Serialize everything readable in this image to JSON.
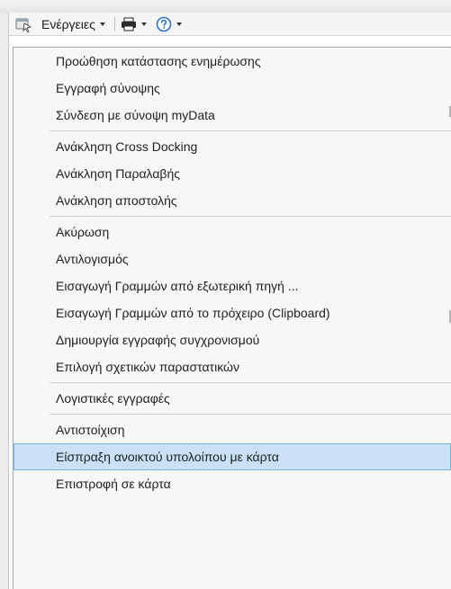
{
  "toolbar": {
    "actions_label": "Ενέργειες",
    "icons": [
      "actions-app-icon",
      "printer-icon",
      "help-icon"
    ]
  },
  "menu": {
    "groups": [
      {
        "items": [
          {
            "label": "Προώθηση κατάστασης ενημέρωσης"
          },
          {
            "label": "Εγγραφή σύνοψης"
          },
          {
            "label": "Σύνδεση με σύνοψη myData"
          }
        ]
      },
      {
        "items": [
          {
            "label": "Ανάκληση Cross Docking"
          },
          {
            "label": "Ανάκληση Παραλαβής"
          },
          {
            "label": "Ανάκληση αποστολής"
          }
        ]
      },
      {
        "items": [
          {
            "label": "Ακύρωση"
          },
          {
            "label": "Αντιλογισμός"
          },
          {
            "label": "Εισαγωγή Γραμμών από εξωτερική πηγή ..."
          },
          {
            "label": "Εισαγωγή Γραμμών από το πρόχειρο (Clipboard)"
          },
          {
            "label": "Δημιουργία εγγραφής συγχρονισμού"
          },
          {
            "label": "Επιλογή σχετικών παραστατικών"
          }
        ]
      },
      {
        "items": [
          {
            "label": "Λογιστικές εγγραφές"
          }
        ]
      },
      {
        "items": [
          {
            "label": "Αντιστοίχιση"
          },
          {
            "label": "Είσπραξη ανοικτού υπολοίπου με κάρτα",
            "highlighted": true
          },
          {
            "label": "Επιστροφή σε κάρτα"
          }
        ]
      }
    ]
  },
  "colors": {
    "menu_bg": "#f7f7f7",
    "highlight_bg": "#c9e0f7",
    "highlight_border": "#7ab1e6",
    "help_icon": "#2a6fc9"
  }
}
